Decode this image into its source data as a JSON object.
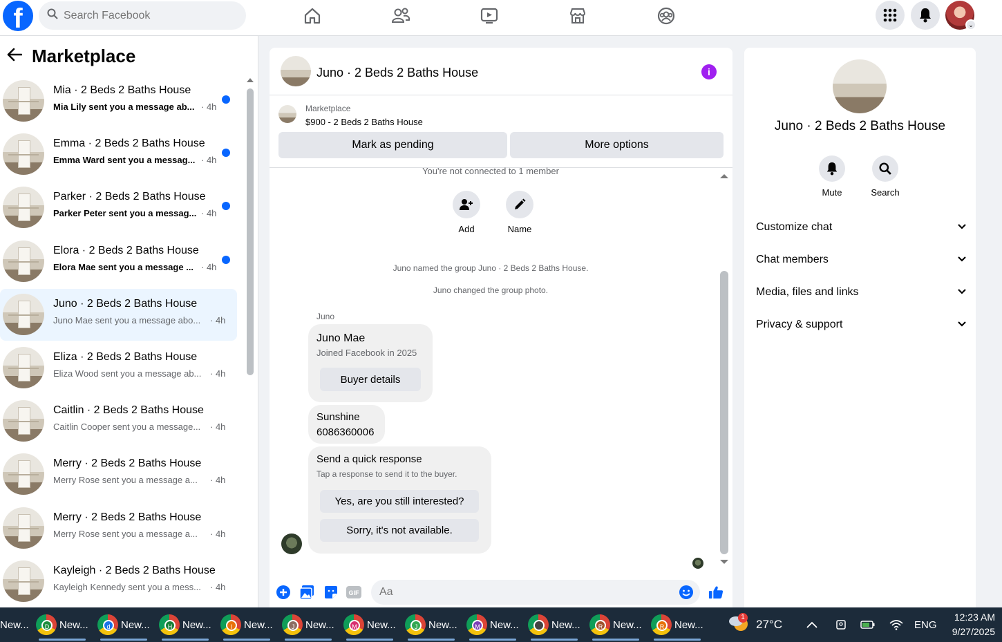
{
  "topbar": {
    "search_placeholder": "Search Facebook",
    "nav": [
      "home-icon",
      "friends-icon",
      "video-icon",
      "marketplace-icon",
      "groups-icon"
    ]
  },
  "marketplace": {
    "title": "Marketplace",
    "conversations": [
      {
        "title": "Mia · 2 Beds 2 Baths House",
        "preview": "Mia Lily sent you a message ab...",
        "time": "· 4h",
        "unread": true
      },
      {
        "title": "Emma · 2 Beds 2 Baths House",
        "preview": "Emma Ward sent you a messag...",
        "time": "· 4h",
        "unread": true
      },
      {
        "title": "Parker · 2 Beds 2 Baths House",
        "preview": "Parker Peter sent you a messag...",
        "time": "· 4h",
        "unread": true
      },
      {
        "title": "Elora · 2 Beds 2 Baths House",
        "preview": "Elora Mae sent you a message ...",
        "time": "· 4h",
        "unread": true
      },
      {
        "title": "Juno · 2 Beds 2 Baths House",
        "preview": "Juno Mae sent you a message abo...",
        "time": "· 4h",
        "unread": false
      },
      {
        "title": "Eliza · 2 Beds 2 Baths House",
        "preview": "Eliza Wood sent you a message ab...",
        "time": "· 4h",
        "unread": false
      },
      {
        "title": "Caitlin · 2 Beds 2 Baths House",
        "preview": "Caitlin Cooper sent you a message...",
        "time": "· 4h",
        "unread": false
      },
      {
        "title": "Merry · 2 Beds 2 Baths House",
        "preview": "Merry Rose sent you a message a...",
        "time": "· 4h",
        "unread": false
      },
      {
        "title": "Merry · 2 Beds 2 Baths House",
        "preview": "Merry Rose sent you a message a...",
        "time": "· 4h",
        "unread": false
      },
      {
        "title": "Kayleigh · 2 Beds 2 Baths House",
        "preview": "Kayleigh Kennedy sent you a mess...",
        "time": "· 4h",
        "unread": false
      }
    ]
  },
  "chat": {
    "title": "Juno · 2 Beds 2 Baths House",
    "listing_source": "Marketplace",
    "listing_price": "$900 - 2 Beds 2 Baths House",
    "mark_pending": "Mark as pending",
    "more_options": "More options",
    "not_connected": "You're not connected to 1 member",
    "add_label": "Add",
    "name_label": "Name",
    "sys_named": "Juno named the group Juno · 2 Beds 2 Baths House.",
    "sys_photo": "Juno changed the group photo.",
    "sender": "Juno",
    "buyer_name": "Juno Mae",
    "buyer_joined": "Joined Facebook in 2025",
    "buyer_details": "Buyer details",
    "msg_line1": "Sunshine",
    "msg_line2": "6086360006",
    "quick_title": "Send a quick response",
    "quick_sub": "Tap a response to send it to the buyer.",
    "quick_1": "Yes, are you still interested?",
    "quick_2": "Sorry, it's not available.",
    "input_placeholder": "Aa"
  },
  "details": {
    "title": "Juno · 2 Beds 2 Baths House",
    "mute": "Mute",
    "search": "Search",
    "sections": [
      "Customize chat",
      "Chat members",
      "Media, files and links",
      "Privacy & support"
    ]
  },
  "taskbar": {
    "first_label": "New...",
    "tasks": [
      {
        "label": "New...",
        "badge": "D",
        "color": "#1e8e3e"
      },
      {
        "label": "New...",
        "badge": "d",
        "color": "#1a73e8"
      },
      {
        "label": "New...",
        "badge": "H",
        "color": "#188038"
      },
      {
        "label": "New...",
        "badge": "I",
        "color": "#e8710a"
      },
      {
        "label": "New...",
        "badge": "J",
        "color": "#8d6e63"
      },
      {
        "label": "New...",
        "badge": "M",
        "color": "#d93070"
      },
      {
        "label": "New...",
        "badge": "J",
        "color": "#34a853"
      },
      {
        "label": "New...",
        "badge": "M",
        "color": "#7b3fb8"
      },
      {
        "label": "New...",
        "badge": "",
        "color": "#444444"
      },
      {
        "label": "New...",
        "badge": "R",
        "color": "#a0522d"
      },
      {
        "label": "New...",
        "badge": "R",
        "color": "#e8710a"
      }
    ],
    "weather": "27°C",
    "weather_badge": "1",
    "lang": "ENG",
    "time": "12:23 AM",
    "date": "9/27/2025"
  },
  "colors": {
    "accent": "#0866ff",
    "unread_dot": "#0866ff",
    "info": "#a020f0"
  }
}
